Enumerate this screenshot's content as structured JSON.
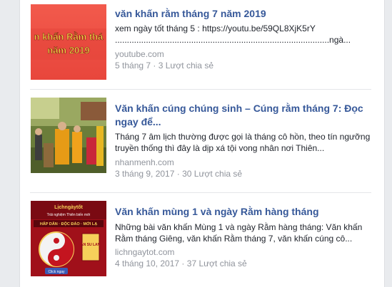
{
  "results": [
    {
      "title": "văn khấn rằm tháng 7 năm 2019",
      "desc_line1": "xem ngày tốt tháng 5 : https://youtu.be/59QL8XjK5rY",
      "desc_line2": "..........................................................................................ngà...",
      "domain": "youtube.com",
      "date": "5 tháng 7",
      "separator": " · ",
      "shares": "3 Lượt chia sẻ",
      "thumb_text_1": "n khấn Rằm thá",
      "thumb_text_2": "năm 2019"
    },
    {
      "title": "Văn khấn cúng chúng sinh – Cúng rằm tháng 7: Đọc ngay để...",
      "desc": "Tháng 7 âm lịch thường được gọi là tháng cô hồn, theo tín ngưỡng truyền thống thì đây là dịp xá tội vong nhân nơi Thiên...",
      "domain": "nhanmenh.com",
      "date": "3 tháng 9, 2017",
      "separator": " · ",
      "shares": "30 Lượt chia sẻ"
    },
    {
      "title": "Văn khấn mùng 1 và ngày Rằm hàng tháng",
      "desc": "Những bài văn khấn Mùng 1 và ngày Rằm hàng tháng: Văn khấn Rằm tháng Giêng, văn khấn Rằm tháng 7, văn khấn cúng cô...",
      "domain": "lichngaytot.com",
      "date": "4 tháng 10, 2017",
      "separator": " · ",
      "shares": "37 Lượt chia sẻ",
      "thumb_logo": "Lịchngàytốt",
      "thumb_tagline": "Trải nghiệm Thiên biến mới",
      "thumb_banner": "HẤP DẪN · ĐỘC ĐÁO · MỚI LẠ",
      "thumb_badge": "VAN SU LANH",
      "thumb_button": "Click ngay"
    }
  ]
}
